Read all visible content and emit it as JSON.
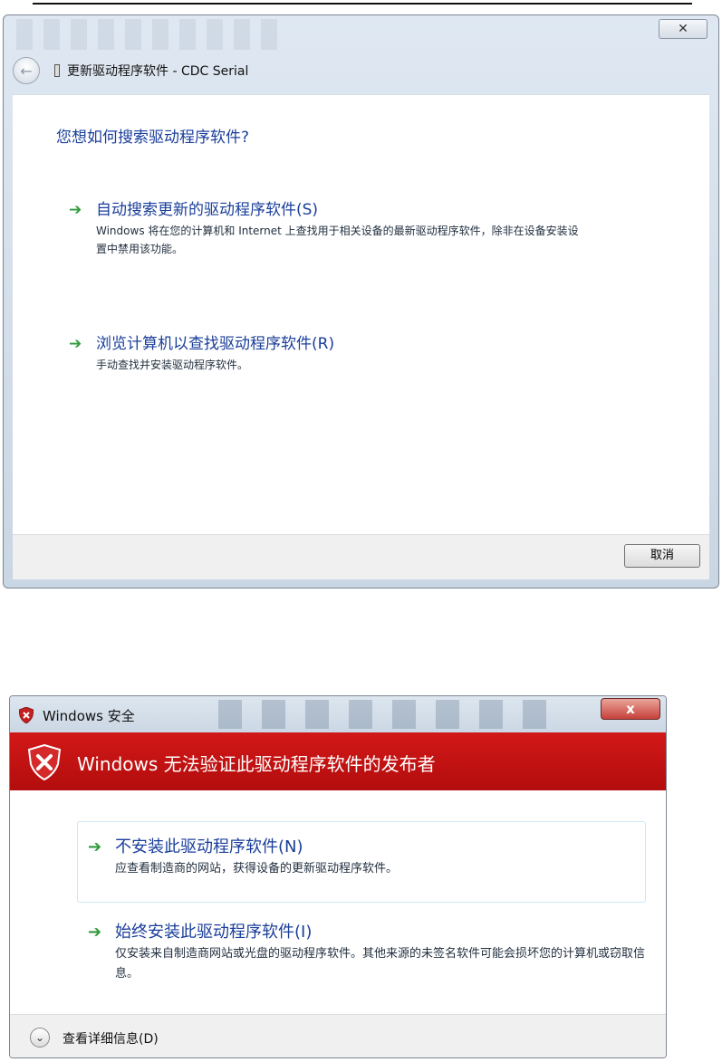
{
  "dialog1": {
    "close_symbol": "✕",
    "back_symbol": "←",
    "nav_title": "更新驱动程序软件 - CDC Serial",
    "question": "您想如何搜索驱动程序软件?",
    "options": [
      {
        "icon": "green-arrow-icon",
        "title": "自动搜索更新的驱动程序软件(S)",
        "description": "Windows 将在您的计算机和 Internet 上查找用于相关设备的最新驱动程序软件，除非在设备安装设置中禁用该功能。"
      },
      {
        "icon": "green-arrow-icon",
        "title": "浏览计算机以查找驱动程序软件(R)",
        "description": "手动查找并安装驱动程序软件。"
      }
    ],
    "cancel_label": "取消"
  },
  "dialog2": {
    "title": "Windows 安全",
    "close_symbol": "x",
    "banner_text": "Windows 无法验证此驱动程序软件的发布者",
    "options": [
      {
        "icon": "green-arrow-icon",
        "title": "不安装此驱动程序软件(N)",
        "description": "应查看制造商的网站，获得设备的更新驱动程序软件。"
      },
      {
        "icon": "green-arrow-icon",
        "title": "始终安装此驱动程序软件(I)",
        "description": "仅安装来自制造商网站或光盘的驱动程序软件。其他来源的未签名软件可能会损坏您的计算机或窃取信息。"
      }
    ],
    "details_symbol": "⌄",
    "details_label": "查看详细信息(D)"
  },
  "colors": {
    "link_blue": "#1a3e9a",
    "arrow_green": "#2f9a3b",
    "banner_red": "#c41212"
  }
}
